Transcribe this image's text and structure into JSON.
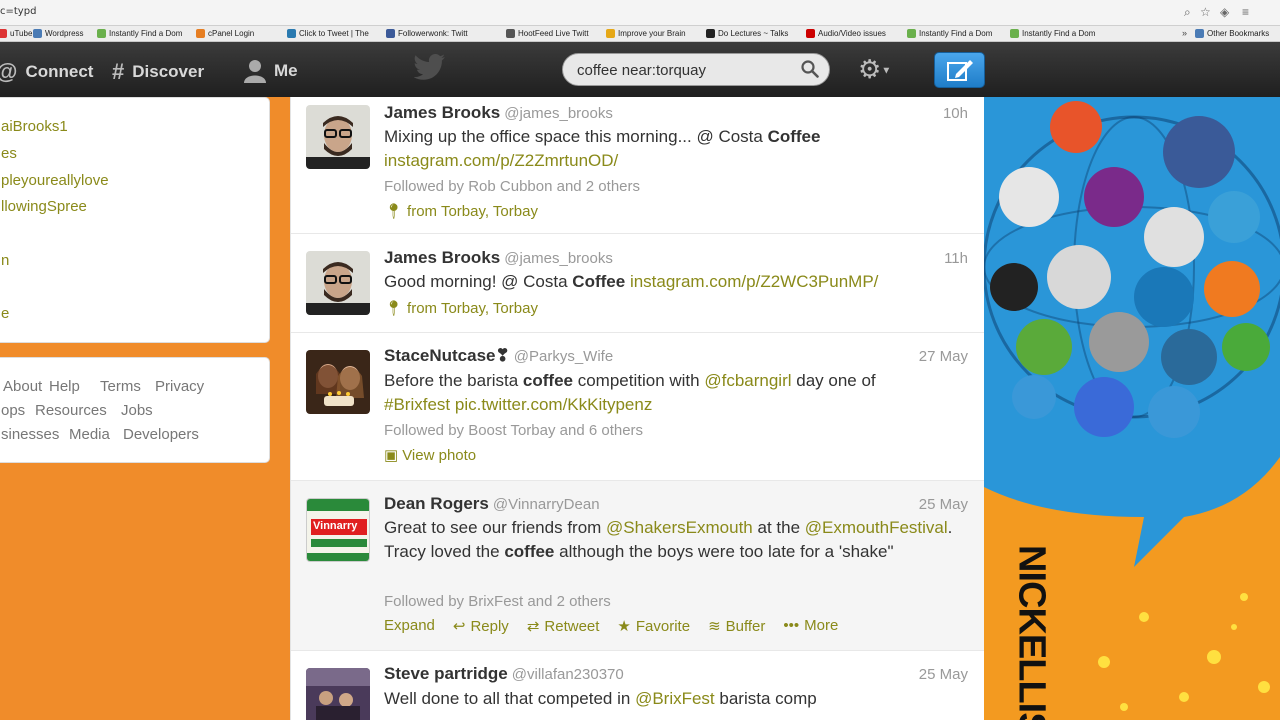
{
  "browser": {
    "url_fragment": "c=typd",
    "bookmarks": [
      {
        "label": "uTube",
        "color": "#d33"
      },
      {
        "label": "Wordpress",
        "color": "#4a7bb5"
      },
      {
        "label": "Instantly Find a Dom",
        "color": "#6ab04c"
      },
      {
        "label": "cPanel Login",
        "color": "#e67e22"
      },
      {
        "label": "Click to Tweet | The",
        "color": "#2a7ab0"
      },
      {
        "label": "Followerwonk: Twitt",
        "color": "#3b5998"
      },
      {
        "label": "HootFeed Live Twitt",
        "color": "#555"
      },
      {
        "label": "Improve your Brain",
        "color": "#e6a817"
      },
      {
        "label": "Do Lectures ~ Talks",
        "color": "#222"
      },
      {
        "label": "Audio/Video issues",
        "color": "#c00"
      },
      {
        "label": "Instantly Find a Dom",
        "color": "#6ab04c"
      },
      {
        "label": "Instantly Find a Dom",
        "color": "#6ab04c"
      },
      {
        "label": "Other Bookmarks",
        "color": "#4a7bb5"
      }
    ]
  },
  "topbar": {
    "nav": [
      {
        "label": "Connect",
        "icon": "at-icon"
      },
      {
        "label": "Discover",
        "icon": "hash-icon"
      },
      {
        "label": "Me",
        "icon": "user-icon"
      }
    ],
    "search_value": "coffee near:torquay",
    "accent": "#1f7dc8"
  },
  "sidebar": {
    "trends": [
      "aiBrooks1",
      "es",
      "pleyoureallylove",
      "llowingSpree",
      "n",
      "",
      "e"
    ],
    "footer_rows": [
      [
        "About",
        "Help",
        "Terms",
        "Privacy"
      ],
      [
        "ops",
        "Resources",
        "Jobs"
      ],
      [
        "sinesses",
        "Media",
        "Developers"
      ]
    ]
  },
  "tweets": [
    {
      "name": "James Brooks",
      "handle": "@james_brooks",
      "time": "10h",
      "text_parts": [
        {
          "t": "Mixing up the office space this morning... @ Costa "
        },
        {
          "t": "Coffee",
          "b": true
        },
        {
          "t": " "
        },
        {
          "t": "instagram.com/p/Z2ZmrtunOD/",
          "link": true
        }
      ],
      "followed": "Followed by Rob Cubbon and 2 others",
      "geo": "from Torbay, Torbay"
    },
    {
      "name": "James Brooks",
      "handle": "@james_brooks",
      "time": "11h",
      "text_parts": [
        {
          "t": "Good morning! @ Costa "
        },
        {
          "t": "Coffee",
          "b": true
        },
        {
          "t": " "
        },
        {
          "t": "instagram.com/p/Z2WC3PunMP/",
          "link": true
        }
      ],
      "geo": "from Torbay, Torbay"
    },
    {
      "name": "StaceNutcase❣",
      "handle": "@Parkys_Wife",
      "time": "27 May",
      "text_parts": [
        {
          "t": "Before the barista "
        },
        {
          "t": "coffee",
          "b": true
        },
        {
          "t": " competition with "
        },
        {
          "t": "@fcbarngirl",
          "link": true
        },
        {
          "t": " day one of "
        },
        {
          "t": "#Brixfest",
          "link": true
        },
        {
          "t": " "
        },
        {
          "t": "pic.twitter.com/KkKitypenz",
          "link": true
        }
      ],
      "followed": "Followed by Boost Torbay and 6 others",
      "view_photo": "View photo"
    },
    {
      "name": "Dean Rogers",
      "handle": "@VinnarryDean",
      "time": "25 May",
      "text_parts": [
        {
          "t": "Great to see our friends from "
        },
        {
          "t": "@ShakersExmouth",
          "link": true
        },
        {
          "t": "  at the "
        },
        {
          "t": "@ExmouthFestival",
          "link": true
        },
        {
          "t": ". Tracy loved the "
        },
        {
          "t": "coffee",
          "b": true
        },
        {
          "t": " although the boys were too late for a 'shake\""
        }
      ],
      "followed": "Followed by BrixFest and 2 others",
      "avatar_text": "Vinnarry",
      "actions": [
        {
          "label": "Expand",
          "icon": ""
        },
        {
          "label": "Reply",
          "icon": "reply-icon"
        },
        {
          "label": "Retweet",
          "icon": "retweet-icon"
        },
        {
          "label": "Favorite",
          "icon": "star-icon"
        },
        {
          "label": "Buffer",
          "icon": "buffer-icon"
        },
        {
          "label": "More",
          "icon": "more-icon"
        }
      ]
    },
    {
      "name": "Steve partridge",
      "handle": "@villafan230370",
      "time": "25 May",
      "text_parts": [
        {
          "t": "Well done to all that competed in "
        },
        {
          "t": "@BrixFest",
          "link": true
        },
        {
          "t": " barista comp"
        }
      ]
    }
  ],
  "art": {
    "vertical_text": "NICKELLIS"
  }
}
